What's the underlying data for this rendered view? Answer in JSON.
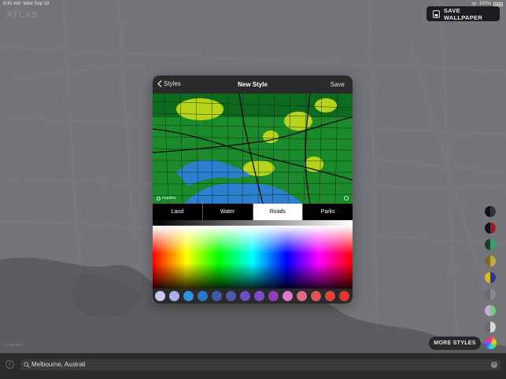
{
  "status_bar": {
    "time": "9:41 AM",
    "date": "Wed Sep 19",
    "battery": "100%"
  },
  "app": {
    "brand": "ATLAS",
    "save_wallpaper_label": "SAVE WALLPAPER"
  },
  "modal": {
    "back_label": "Styles",
    "title": "New Style",
    "save_label": "Save",
    "preview_attribution": "mapbox",
    "tabs": [
      {
        "label": "Land",
        "active": false
      },
      {
        "label": "Water",
        "active": false
      },
      {
        "label": "Roads",
        "active": true
      },
      {
        "label": "Parks",
        "active": false
      }
    ],
    "swatches": [
      "#c9c9f5",
      "#a9aee8",
      "#2f8fe0",
      "#2a78c6",
      "#3d5ea6",
      "#5358a8",
      "#6b4fc2",
      "#7d4cc8",
      "#8f3fb8",
      "#e079c9",
      "#e06a7e",
      "#e0564f",
      "#e0443a",
      "#e03a2a"
    ]
  },
  "style_dots": [
    {
      "left": "#111111",
      "right": "#333333"
    },
    {
      "left": "#111111",
      "right": "#a01828"
    },
    {
      "left": "#1f3a2c",
      "right": "#2fa46a"
    },
    {
      "left": "#7c6b28",
      "right": "#c9a83b"
    },
    {
      "left": "#d9b820",
      "right": "#2a3a9a"
    },
    {
      "left": "#6a6b6e",
      "right": "#8a8b8e"
    },
    {
      "left": "#c8a8e0",
      "right": "#6fcf7a"
    },
    {
      "left": "#6a6b6e",
      "right": "#d8d8d8"
    }
  ],
  "more_styles_label": "MORE STYLES",
  "search": {
    "value": "Melbourne, Australi"
  },
  "map_attribution": "© mapbox"
}
